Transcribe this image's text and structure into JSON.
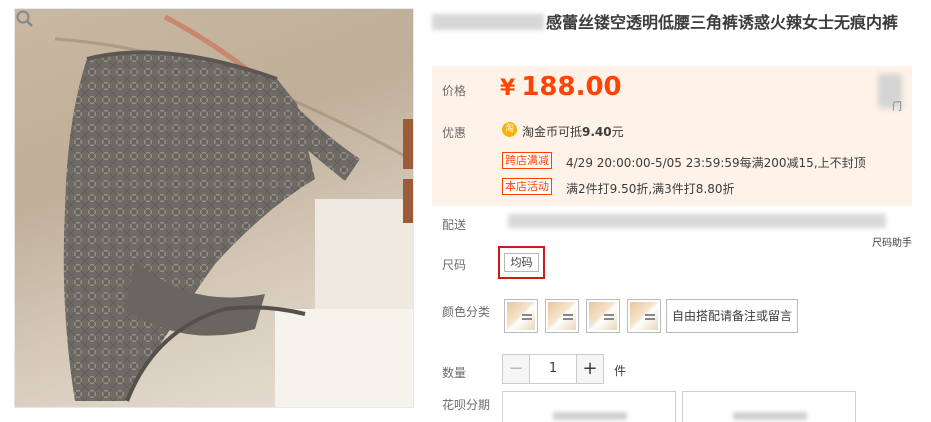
{
  "product": {
    "title": "感蕾丝镂空透明低腰三角裤诱惑火辣女士无痕内裤"
  },
  "price": {
    "label": "价格",
    "currency": "¥",
    "value": "188.00",
    "side_char": "门"
  },
  "promo": {
    "label": "优惠",
    "coin_icon": "淘",
    "coin_text": "淘金币可抵",
    "coin_amount": "9.40",
    "coin_unit": "元",
    "tags": [
      {
        "tag": "跨店满减",
        "text": "4/29 20:00:00-5/05 23:59:59每满200减15,上不封顶"
      },
      {
        "tag": "本店活动",
        "text": "满2件打9.50折,满3件打8.80折"
      }
    ]
  },
  "shipping": {
    "label": "配送",
    "size_help": "尺码助手"
  },
  "size": {
    "label": "尺码",
    "option": "均码"
  },
  "color": {
    "label": "颜色分类",
    "combo_option": "自由搭配请备注或留言"
  },
  "quantity": {
    "label": "数量",
    "minus": "−",
    "value": "1",
    "plus": "+",
    "unit": "件"
  },
  "installment": {
    "label": "花呗分期"
  },
  "colors": {
    "price": "#ff4400",
    "price_bg": "#fff2e8",
    "selected_border": "#cc1a1a"
  }
}
